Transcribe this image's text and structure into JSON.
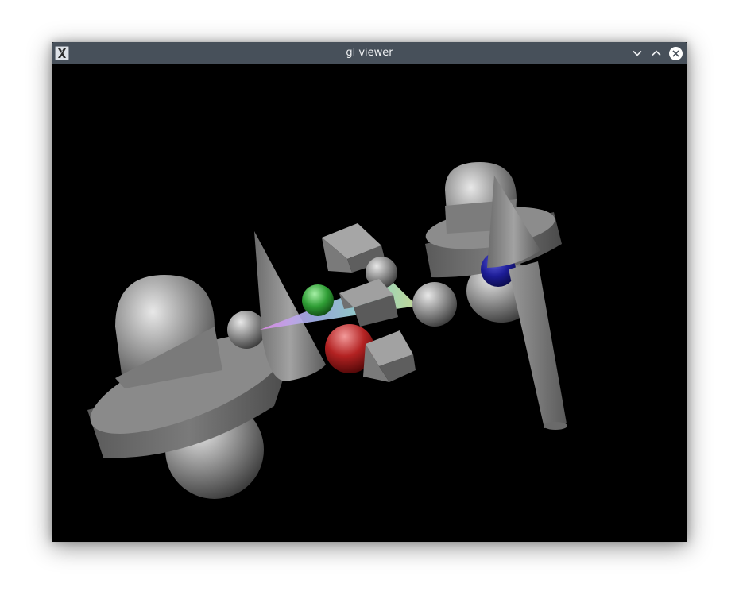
{
  "window": {
    "title": "gl viewer",
    "app_icon": "x11-icon",
    "controls": {
      "minimize_icon": "chevron-down-icon",
      "maximize_icon": "chevron-up-icon",
      "close_icon": "close-icon"
    }
  },
  "scene": {
    "background": "#000000",
    "objects": [
      "capsule-left",
      "disc-left",
      "cone-left",
      "sphere-small-left",
      "sphere-green",
      "sphere-red",
      "cube-top",
      "cube-middle",
      "cube-bottom",
      "sphere-small-top",
      "sphere-white-right",
      "triangle-rainbow",
      "capsule-right",
      "disc-right",
      "sphere-blue",
      "cone-right",
      "cylinder-rod"
    ],
    "colors": {
      "red_sphere": "#a01818",
      "green_sphere": "#1f9a2e",
      "blue_sphere": "#1a1a8a",
      "gray_object": "#8c8c8c"
    }
  }
}
